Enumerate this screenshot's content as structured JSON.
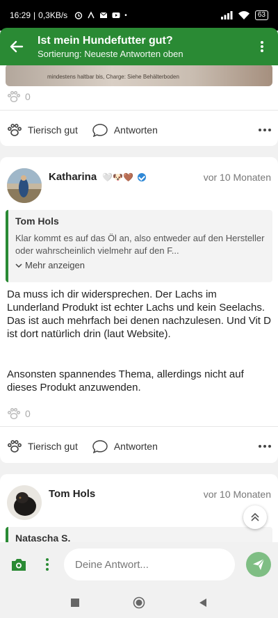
{
  "status_bar": {
    "time": "16:29",
    "speed": "0,3KB/s",
    "battery": "63"
  },
  "app_bar": {
    "title": "Ist mein Hundefutter gut?",
    "subtitle": "Sortierung: Neueste Antworten oben"
  },
  "post0": {
    "image_text": "mindestens haltbar bis, Charge: Siehe Behälterboden",
    "likes": "0",
    "actions": {
      "like": "Tierisch gut",
      "reply": "Antworten"
    }
  },
  "comment1": {
    "author": "Katharina",
    "emoji": "🤍🐶🤎",
    "time": "vor 10 Monaten",
    "quote": {
      "author": "Tom Hols",
      "text": "Klar kommt es auf das Öl an, also entweder auf den Hersteller oder wahrscheinlich vielmehr auf den F...",
      "more": "Mehr anzeigen"
    },
    "paragraph1": "Da muss ich dir widersprechen. Der Lachs im Lunderland Produkt ist echter Lachs und kein Seelachs. Das ist auch mehrfach bei denen nachzulesen. Und Vit D ist dort natürlich drin (laut Website).",
    "paragraph2": "Ansonsten spannendes Thema, allerdings nicht auf dieses Produkt anzuwenden.",
    "likes": "0",
    "actions": {
      "like": "Tierisch gut",
      "reply": "Antworten"
    }
  },
  "comment2": {
    "author": "Tom Hols",
    "time": "vor 10 Monaten",
    "quote": {
      "author": "Natascha S."
    }
  },
  "compose": {
    "placeholder": "Deine Antwort..."
  },
  "colors": {
    "brand": "#2a8a34",
    "send_button": "#7fbe84",
    "verified": "#2f88d6"
  }
}
